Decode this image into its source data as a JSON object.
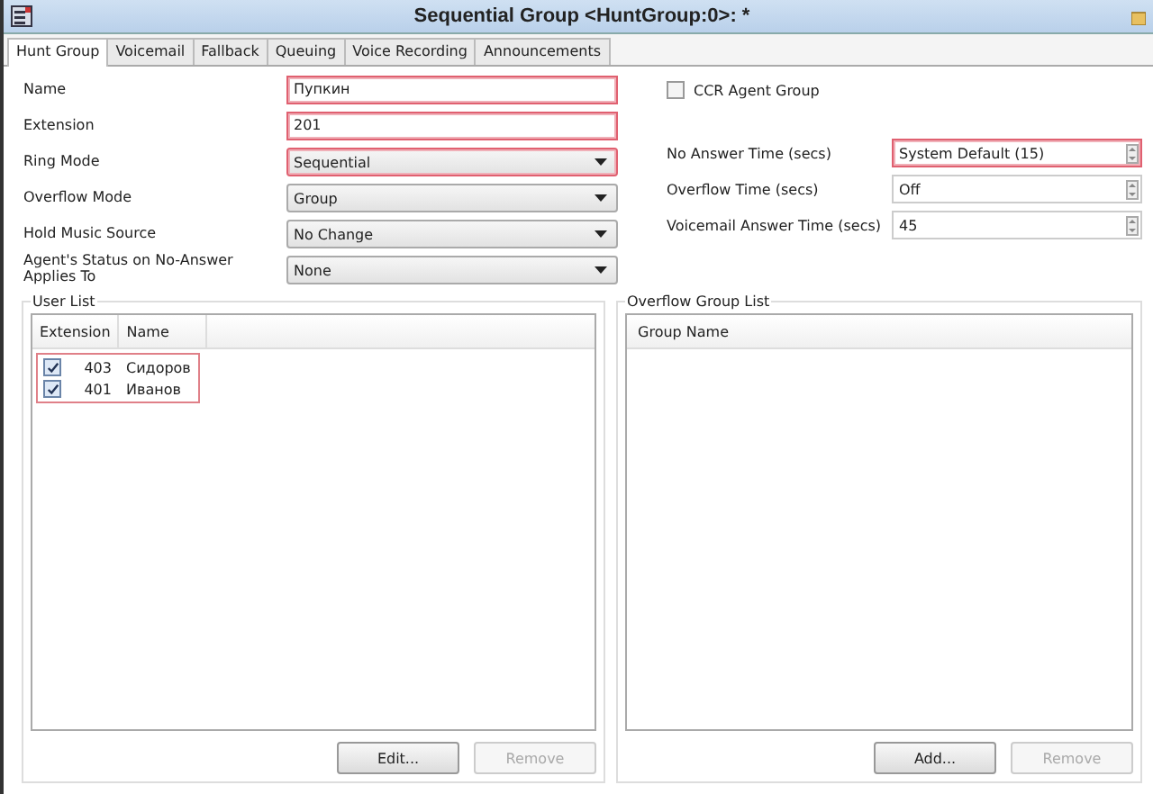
{
  "window": {
    "title": "Sequential Group <HuntGroup:0>: *"
  },
  "tabs": [
    {
      "label": "Hunt Group",
      "selected": true
    },
    {
      "label": "Voicemail",
      "selected": false
    },
    {
      "label": "Fallback",
      "selected": false
    },
    {
      "label": "Queuing",
      "selected": false
    },
    {
      "label": "Voice Recording",
      "selected": false
    },
    {
      "label": "Announcements",
      "selected": false
    }
  ],
  "left_fields": [
    {
      "label": "Name",
      "kind": "text",
      "value": "Пупкин",
      "highlighted": true
    },
    {
      "label": "Extension",
      "kind": "text",
      "value": "201",
      "highlighted": true
    },
    {
      "label": "Ring Mode",
      "kind": "dropdown",
      "value": "Sequential",
      "highlighted": true
    },
    {
      "label": "Overflow Mode",
      "kind": "dropdown",
      "value": "Group",
      "highlighted": false
    },
    {
      "label": "Hold Music Source",
      "kind": "dropdown",
      "value": "No Change",
      "highlighted": false
    },
    {
      "label": "Agent's Status on No-Answer Applies To",
      "kind": "dropdown",
      "value": "None",
      "highlighted": false
    }
  ],
  "ccr_agent_group": {
    "label": "CCR Agent Group",
    "checked": false
  },
  "right_fields": [
    {
      "label": "No Answer Time (secs)",
      "value": "System Default (15)",
      "highlighted": true
    },
    {
      "label": "Overflow Time (secs)",
      "value": "Off",
      "highlighted": false
    },
    {
      "label": "Voicemail Answer Time (secs)",
      "value": "45",
      "highlighted": false
    }
  ],
  "user_list": {
    "title": "User List",
    "columns": [
      "Extension",
      "Name"
    ],
    "rows": [
      {
        "extension": "403",
        "name": "Сидоров",
        "checked": true
      },
      {
        "extension": "401",
        "name": "Иванов",
        "checked": true
      }
    ],
    "buttons": [
      {
        "label": "Edit...",
        "disabled": false
      },
      {
        "label": "Remove",
        "disabled": true
      }
    ]
  },
  "overflow_group_list": {
    "title": "Overflow Group List",
    "columns": [
      "Group Name"
    ],
    "buttons": [
      {
        "label": "Add...",
        "disabled": false
      },
      {
        "label": "Remove",
        "disabled": true
      }
    ]
  }
}
